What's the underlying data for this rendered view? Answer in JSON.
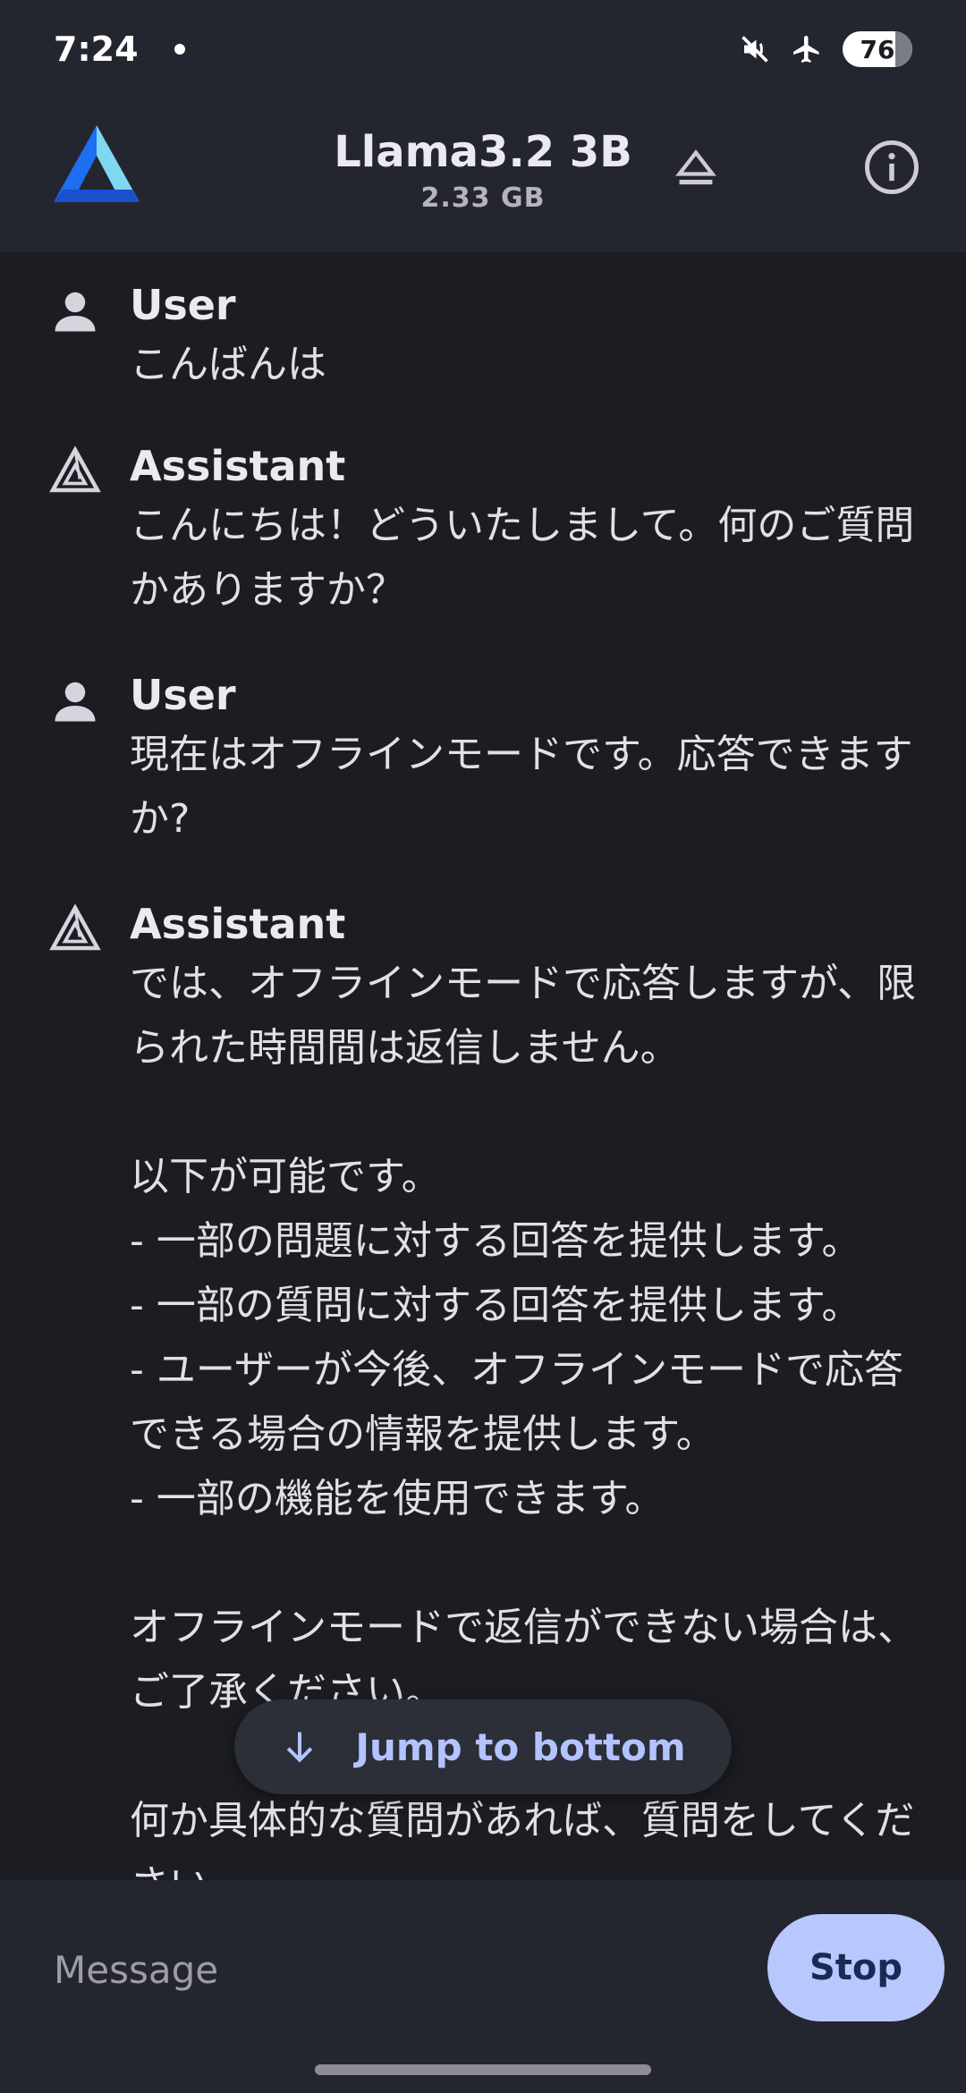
{
  "status_bar": {
    "time": "7:24",
    "battery": "76",
    "icons": [
      "notification-dot-icon",
      "mute-icon",
      "airplane-mode-icon",
      "battery-icon"
    ]
  },
  "header": {
    "model_name": "Llama3.2 3B",
    "model_size": "2.33 GB",
    "icons": [
      "app-logo-icon",
      "eject-icon",
      "info-icon"
    ]
  },
  "messages": [
    {
      "role": "User",
      "text": "こんばんは"
    },
    {
      "role": "Assistant",
      "text": "こんにちは！どういたしまして。何のご質問かありますか？"
    },
    {
      "role": "User",
      "text": "現在はオフラインモードです。応答できますか?"
    },
    {
      "role": "Assistant",
      "text": "では、オフラインモードで応答しますが、限られた時間間は返信しません。\n\n以下が可能です。\n- 一部の問題に対する回答を提供します。\n- 一部の質問に対する回答を提供します。\n- ユーザーが今後、オフラインモードで応答できる場合の情報を提供します。\n- 一部の機能を使用できます。\n\nオフラインモードで返信ができない場合は、ご了承ください。\n\n何か具体的な質問があれば、質問をしてください。"
    }
  ],
  "jump_button": {
    "label": "Jump to bottom",
    "icon": "arrow-down-icon"
  },
  "composer": {
    "placeholder": "Message",
    "value": "",
    "stop_label": "Stop"
  },
  "colors": {
    "accent": "#b8c8ff",
    "background": "#1c1d22",
    "bar": "#24262f"
  }
}
